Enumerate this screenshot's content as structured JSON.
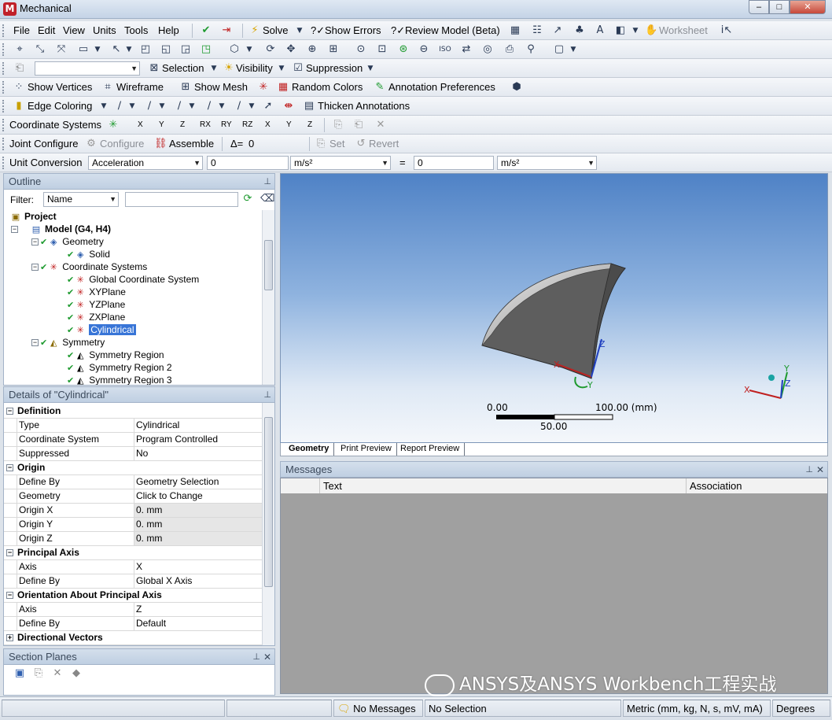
{
  "window": {
    "title": "Mechanical",
    "app_icon": "M",
    "controls": [
      "–",
      "□",
      "✕"
    ]
  },
  "menu": [
    "File",
    "Edit",
    "View",
    "Units",
    "Tools",
    "Help"
  ],
  "toolbar1": {
    "solve": "Solve",
    "show_errors": "Show Errors",
    "review_model": "Review Model (Beta)",
    "worksheet": "Worksheet"
  },
  "toolbar3": {
    "selection": "Selection",
    "visibility": "Visibility",
    "suppression": "Suppression"
  },
  "toolbar4": {
    "show_vertices": "Show Vertices",
    "wireframe": "Wireframe",
    "show_mesh": "Show Mesh",
    "random_colors": "Random Colors",
    "annotation_prefs": "Annotation Preferences"
  },
  "toolbar5": {
    "edge_coloring": "Edge Coloring",
    "thicken_annotations": "Thicken Annotations"
  },
  "toolbar6": {
    "coordinate_systems": "Coordinate Systems",
    "axis_labels": [
      "X",
      "Y",
      "Z",
      "RX",
      "RY",
      "RZ",
      "X",
      "Y",
      "Z"
    ]
  },
  "toolbar7": {
    "joint_configure": "Joint Configure",
    "configure": "Configure",
    "assemble": "Assemble",
    "delta_label": "Δ=",
    "delta_value": "0",
    "set": "Set",
    "revert": "Revert"
  },
  "toolbar8": {
    "unit_conversion": "Unit Conversion",
    "quantity": "Acceleration",
    "value_in": "0",
    "unit_in": "m/s²",
    "equals": "=",
    "value_out": "0",
    "unit_out": "m/s²"
  },
  "outline": {
    "title": "Outline",
    "filter_label": "Filter:",
    "filter_value": "Name",
    "tree": {
      "project": "Project",
      "model": "Model (G4, H4)",
      "geometry": "Geometry",
      "solid": "Solid",
      "coordinate_systems": "Coordinate Systems",
      "global_cs": "Global Coordinate System",
      "xyplane": "XYPlane",
      "yzplane": "YZPlane",
      "zxplane": "ZXPlane",
      "cylindrical": "Cylindrical",
      "symmetry": "Symmetry",
      "symmetry_region": "Symmetry Region",
      "symmetry_region_2": "Symmetry Region 2",
      "symmetry_region_3": "Symmetry Region 3"
    }
  },
  "details": {
    "title": "Details of \"Cylindrical\"",
    "groups": [
      {
        "name": "Definition",
        "rows": [
          [
            "Type",
            "Cylindrical"
          ],
          [
            "Coordinate System",
            "Program Controlled"
          ],
          [
            "Suppressed",
            "No"
          ]
        ]
      },
      {
        "name": "Origin",
        "rows": [
          [
            "Define By",
            "Geometry Selection"
          ],
          [
            "Geometry",
            "Click to Change"
          ],
          [
            "Origin X",
            "0. mm"
          ],
          [
            "Origin Y",
            "0. mm"
          ],
          [
            "Origin Z",
            "0. mm"
          ]
        ]
      },
      {
        "name": "Principal Axis",
        "rows": [
          [
            "Axis",
            "X"
          ],
          [
            "Define By",
            "Global X Axis"
          ]
        ]
      },
      {
        "name": "Orientation About Principal Axis",
        "rows": [
          [
            "Axis",
            "Z"
          ],
          [
            "Define By",
            "Default"
          ]
        ]
      },
      {
        "name": "Directional Vectors",
        "rows": []
      }
    ]
  },
  "section_planes": {
    "title": "Section Planes"
  },
  "viewport": {
    "scale_left": "0.00",
    "scale_right": "100.00 (mm)",
    "scale_mid": "50.00",
    "tabs": [
      "Geometry",
      "Print Preview",
      "Report Preview"
    ],
    "triad_labels": {
      "x": "X",
      "y": "Y",
      "z": "Z"
    }
  },
  "messages": {
    "title": "Messages",
    "col_text": "Text",
    "col_association": "Association"
  },
  "status": {
    "messages": "No Messages",
    "selection": "No Selection",
    "units": "Metric (mm, kg, N, s, mV, mA)",
    "angle": "Degrees"
  },
  "watermark": "ANSYS及ANSYS Workbench工程实战",
  "colors": {
    "accent": "#3875d7",
    "check": "#1e9a2f",
    "viewport_top": "#4f82c6"
  }
}
